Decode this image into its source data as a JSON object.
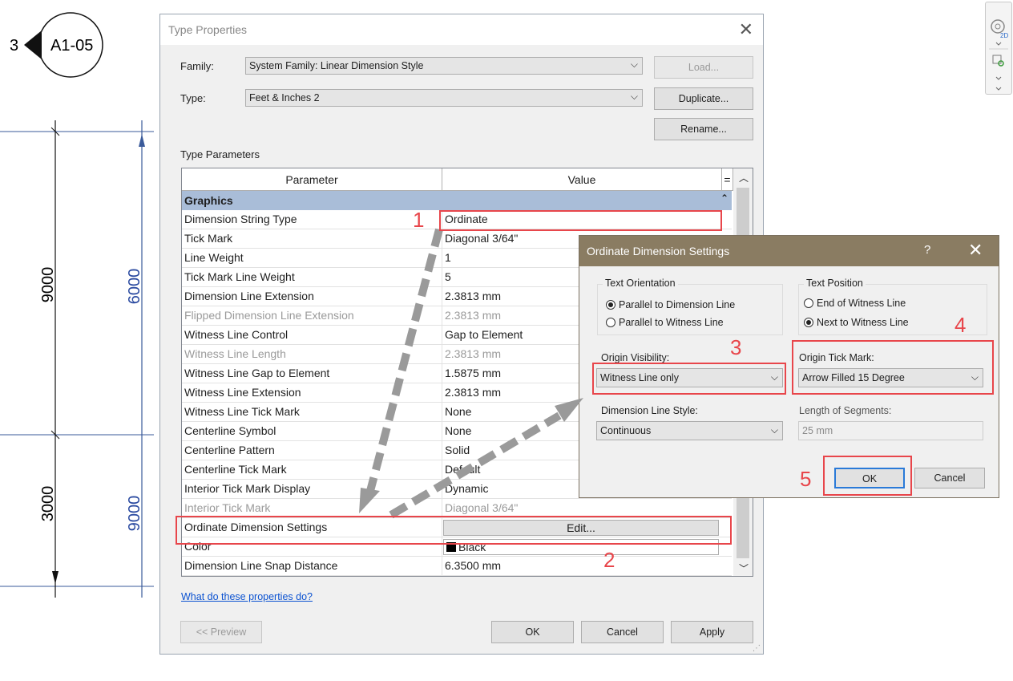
{
  "drawing": {
    "callout_number": "3",
    "callout_sheet": "A1-05",
    "dims_left": [
      "9000",
      "3000"
    ],
    "dims_right": [
      "6000",
      "9000"
    ]
  },
  "type_properties": {
    "title": "Type Properties",
    "family_label": "Family:",
    "family_value": "System Family: Linear Dimension Style",
    "type_label": "Type:",
    "type_value": "Feet & Inches 2",
    "load_button": "Load...",
    "duplicate_button": "Duplicate...",
    "rename_button": "Rename...",
    "type_parameters_label": "Type Parameters",
    "col_parameter": "Parameter",
    "col_value": "Value",
    "col_equals": "=",
    "section": "Graphics",
    "rows": [
      {
        "param": "Dimension String Type",
        "value": "Ordinate"
      },
      {
        "param": "Tick Mark",
        "value": "Diagonal 3/64\""
      },
      {
        "param": "Line Weight",
        "value": "1"
      },
      {
        "param": "Tick Mark Line Weight",
        "value": "5"
      },
      {
        "param": "Dimension Line Extension",
        "value": "2.3813 mm"
      },
      {
        "param": "Flipped Dimension Line Extension",
        "value": "2.3813 mm"
      },
      {
        "param": "Witness Line Control",
        "value": "Gap to Element"
      },
      {
        "param": "Witness Line Length",
        "value": "2.3813 mm"
      },
      {
        "param": "Witness Line Gap to Element",
        "value": "1.5875 mm"
      },
      {
        "param": "Witness Line Extension",
        "value": "2.3813 mm"
      },
      {
        "param": "Witness Line Tick Mark",
        "value": "None"
      },
      {
        "param": "Centerline Symbol",
        "value": "None"
      },
      {
        "param": "Centerline Pattern",
        "value": "Solid"
      },
      {
        "param": "Centerline Tick Mark",
        "value": "Default"
      },
      {
        "param": "Interior Tick Mark Display",
        "value": "Dynamic"
      },
      {
        "param": "Interior Tick Mark",
        "value": "Diagonal 3/64\""
      },
      {
        "param": "Ordinate Dimension Settings",
        "value": "Edit..."
      },
      {
        "param": "Color",
        "value": "Black"
      },
      {
        "param": "Dimension Line Snap Distance",
        "value": "6.3500 mm"
      }
    ],
    "help_link": "What do these properties do?",
    "preview_button": "<< Preview",
    "ok_button": "OK",
    "cancel_button": "Cancel",
    "apply_button": "Apply"
  },
  "ordinate_dialog": {
    "title": "Ordinate Dimension Settings",
    "help": "?",
    "text_orientation_label": "Text Orientation",
    "orient_parallel_dim": "Parallel to Dimension Line",
    "orient_parallel_witness": "Parallel to Witness Line",
    "text_position_label": "Text Position",
    "pos_end_witness": "End of Witness Line",
    "pos_next_witness": "Next to Witness Line",
    "origin_visibility_label": "Origin Visibility:",
    "origin_visibility_value": "Witness Line only",
    "origin_tick_label": "Origin Tick Mark:",
    "origin_tick_value": "Arrow Filled 15 Degree",
    "dim_line_style_label": "Dimension Line Style:",
    "dim_line_style_value": "Continuous",
    "length_segments_label": "Length of Segments:",
    "length_segments_value": "25 mm",
    "ok_button": "OK",
    "cancel_button": "Cancel"
  },
  "annotations": [
    "1",
    "2",
    "3",
    "4",
    "5"
  ],
  "colors": {
    "annotation": "#e8464b",
    "section_header": "#a9bdd8",
    "dialog_title": "#8a7c62",
    "link": "#0b52d1"
  }
}
